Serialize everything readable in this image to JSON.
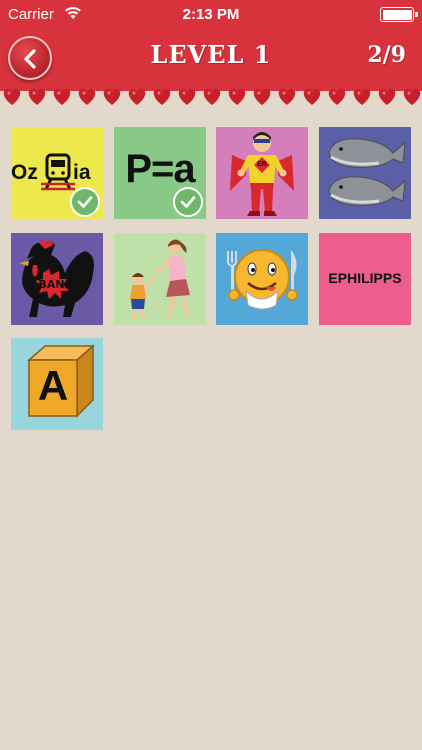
{
  "status_bar": {
    "carrier": "Carrier",
    "time": "2:13 PM"
  },
  "header": {
    "title": "LEVEL 1",
    "progress": "2/9",
    "back_icon": "chevron-left-icon"
  },
  "colors": {
    "header_red": "#d8333c",
    "background": "#e2d9cc",
    "check_green": "#6fb86a"
  },
  "puzzles": [
    {
      "text_left": "Oz",
      "text_right": "ia",
      "icon": "train-icon",
      "solved": true,
      "bg": "#ede84c"
    },
    {
      "text": "P=a",
      "solved": true,
      "bg": "#88c987"
    },
    {
      "badge": "ER",
      "icon": "superhero-icon",
      "solved": false,
      "bg": "#d47fba"
    },
    {
      "icon": "whales-icon",
      "solved": false,
      "bg": "#5a5fa6"
    },
    {
      "text": "BANG",
      "icon": "rooster-icon",
      "solved": false,
      "bg": "#6a5aa6"
    },
    {
      "icon": "mother-child-icon",
      "solved": false,
      "bg": "#bfe0a8"
    },
    {
      "icon": "hungry-smiley-icon",
      "solved": false,
      "bg": "#53a8d8"
    },
    {
      "text": "EPHILIPPS",
      "solved": false,
      "bg": "#ec5e8e"
    },
    {
      "text": "A",
      "icon": "cube-block-icon",
      "solved": false,
      "bg": "#98d6de"
    }
  ]
}
